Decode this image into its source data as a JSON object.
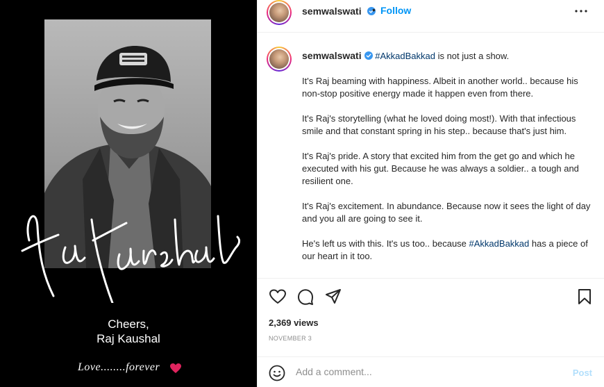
{
  "media": {
    "cheers_line1": "Cheers,",
    "cheers_line2": "Raj Kaushal",
    "love_text": "Love........forever",
    "heart_color": "#e0245e",
    "signature": "Raj Kaushal"
  },
  "header": {
    "username": "semwalswati",
    "separator": "•",
    "follow_label": "Follow",
    "more_icon": "more-horizontal-icon"
  },
  "caption": {
    "username": "semwalswati",
    "hashtag1": "#AkkadBakkad",
    "intro_rest": " is not just a show.",
    "paragraphs": [
      "It's Raj beaming with happiness. Albeit in another world.. because his non-stop positive energy made it happen even from there.",
      "It's Raj's storytelling (what he loved doing most!). With that infectious smile and that constant spring in his step.. because that's just him.",
      "It's Raj's pride. A story that excited him from the get go and which he executed with his gut. Because he was always a soldier.. a tough and resilient one.",
      "It's Raj's excitement. In abundance. Because now it sees the light of day and you all are going to see it."
    ],
    "last_before": "He's left us with this. It's us too.. because ",
    "hashtag2": "#AkkadBakkad",
    "last_after": " has a piece of our heart in it too."
  },
  "actions": {
    "like_icon": "heart-icon",
    "comment_icon": "comment-icon",
    "share_icon": "share-icon",
    "save_icon": "bookmark-icon"
  },
  "stats": {
    "views": "2,369 views",
    "date": "NOVEMBER 3"
  },
  "comment": {
    "placeholder": "Add a comment...",
    "post_label": "Post"
  },
  "colors": {
    "accent": "#0095f6",
    "hashtag": "#00376b",
    "verified": "#3897f0",
    "muted": "#8e8e8e"
  }
}
